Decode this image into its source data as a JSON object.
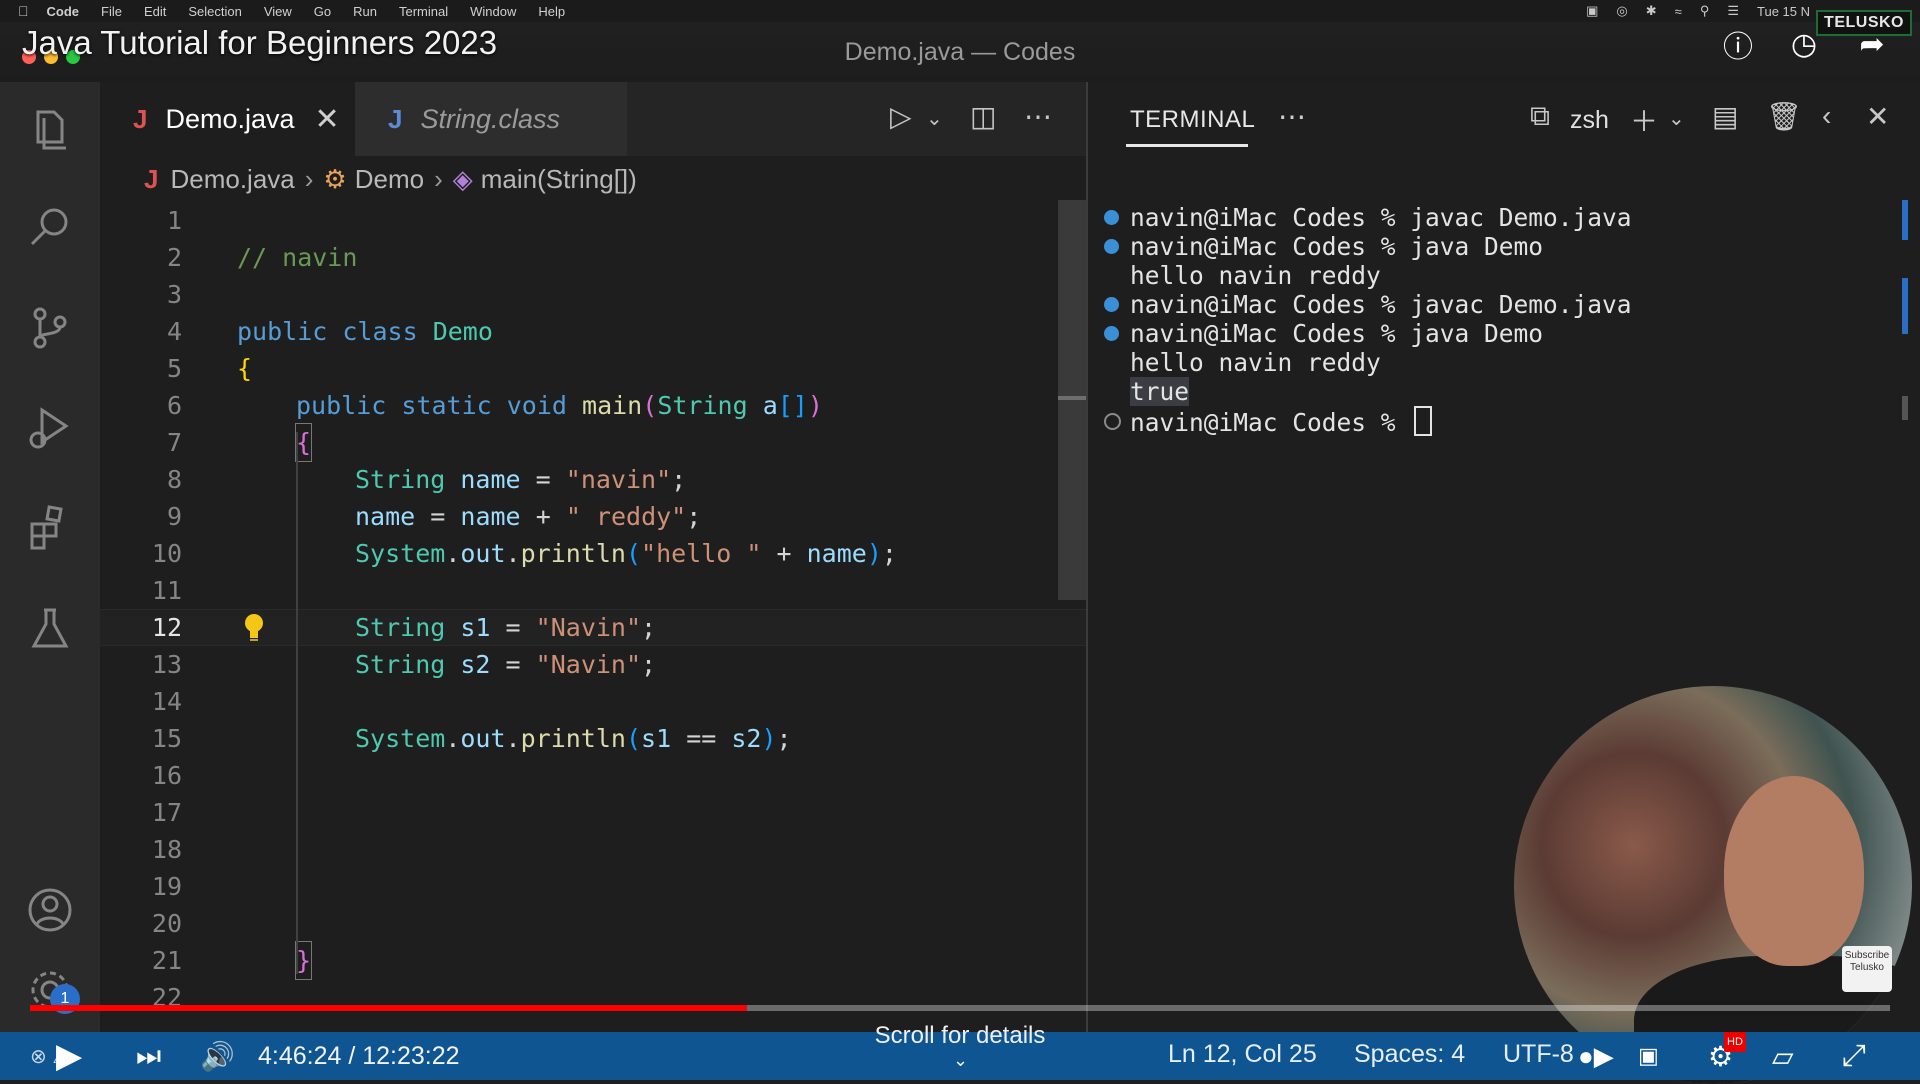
{
  "menubar": {
    "app": "Code",
    "items": [
      "File",
      "Edit",
      "Selection",
      "View",
      "Go",
      "Run",
      "Terminal",
      "Window",
      "Help"
    ],
    "clock": "Tue 15 N"
  },
  "video": {
    "title": "Java Tutorial for Beginners 2023",
    "channel": "TELUSKO",
    "current_time": "4:46:24",
    "duration": "12:23:22",
    "time_display": "4:46:24 / 12:23:22",
    "progress_fraction": 0.3857,
    "scroll_hint": "Scroll for details",
    "subscribe_label": "Subscribe Telusko",
    "hd_badge": "HD"
  },
  "window": {
    "title": "Demo.java — Codes"
  },
  "editor": {
    "tabs": [
      {
        "label": "Demo.java",
        "active": true
      },
      {
        "label": "String.class",
        "active": false
      }
    ],
    "breadcrumb": {
      "file": "Demo.java",
      "class": "Demo",
      "method": "main(String[])"
    },
    "current_line": 12,
    "lines": [
      "1",
      "2",
      "3",
      "4",
      "5",
      "6",
      "7",
      "8",
      "9",
      "10",
      "11",
      "12",
      "13",
      "14",
      "15",
      "16",
      "17",
      "18",
      "19",
      "20",
      "21",
      "22"
    ],
    "code": {
      "l2": "// navin",
      "l4a": "public",
      "l4b": "class",
      "l4c": "Demo",
      "l5": "{",
      "l8_type": "String",
      "l8_var": "name",
      "l8_str": "\"navin\"",
      "l9_str": "\" reddy\"",
      "l10_str": "\"hello \"",
      "l12_var": "s1",
      "l12_str": "\"Navin\"",
      "l13_var": "s2",
      "l13_str": "\"Navin\""
    }
  },
  "terminal": {
    "tab": "TERMINAL",
    "shell": "zsh",
    "lines": [
      "navin@iMac Codes % javac Demo.java",
      "navin@iMac Codes % java Demo",
      "hello navin reddy",
      "navin@iMac Codes % javac Demo.java",
      "navin@iMac Codes % java Demo",
      "hello navin reddy",
      "true",
      "navin@iMac Codes % "
    ]
  },
  "statusbar": {
    "position": "Ln 12, Col 25",
    "spaces": "Spaces: 4",
    "encoding": "UTF-8",
    "notifications": "1"
  },
  "colors": {
    "statusbar": "#0f5592",
    "progress": "#ff0000",
    "keyword": "#569cd6",
    "string": "#ce9178",
    "type": "#4ec9b0"
  }
}
